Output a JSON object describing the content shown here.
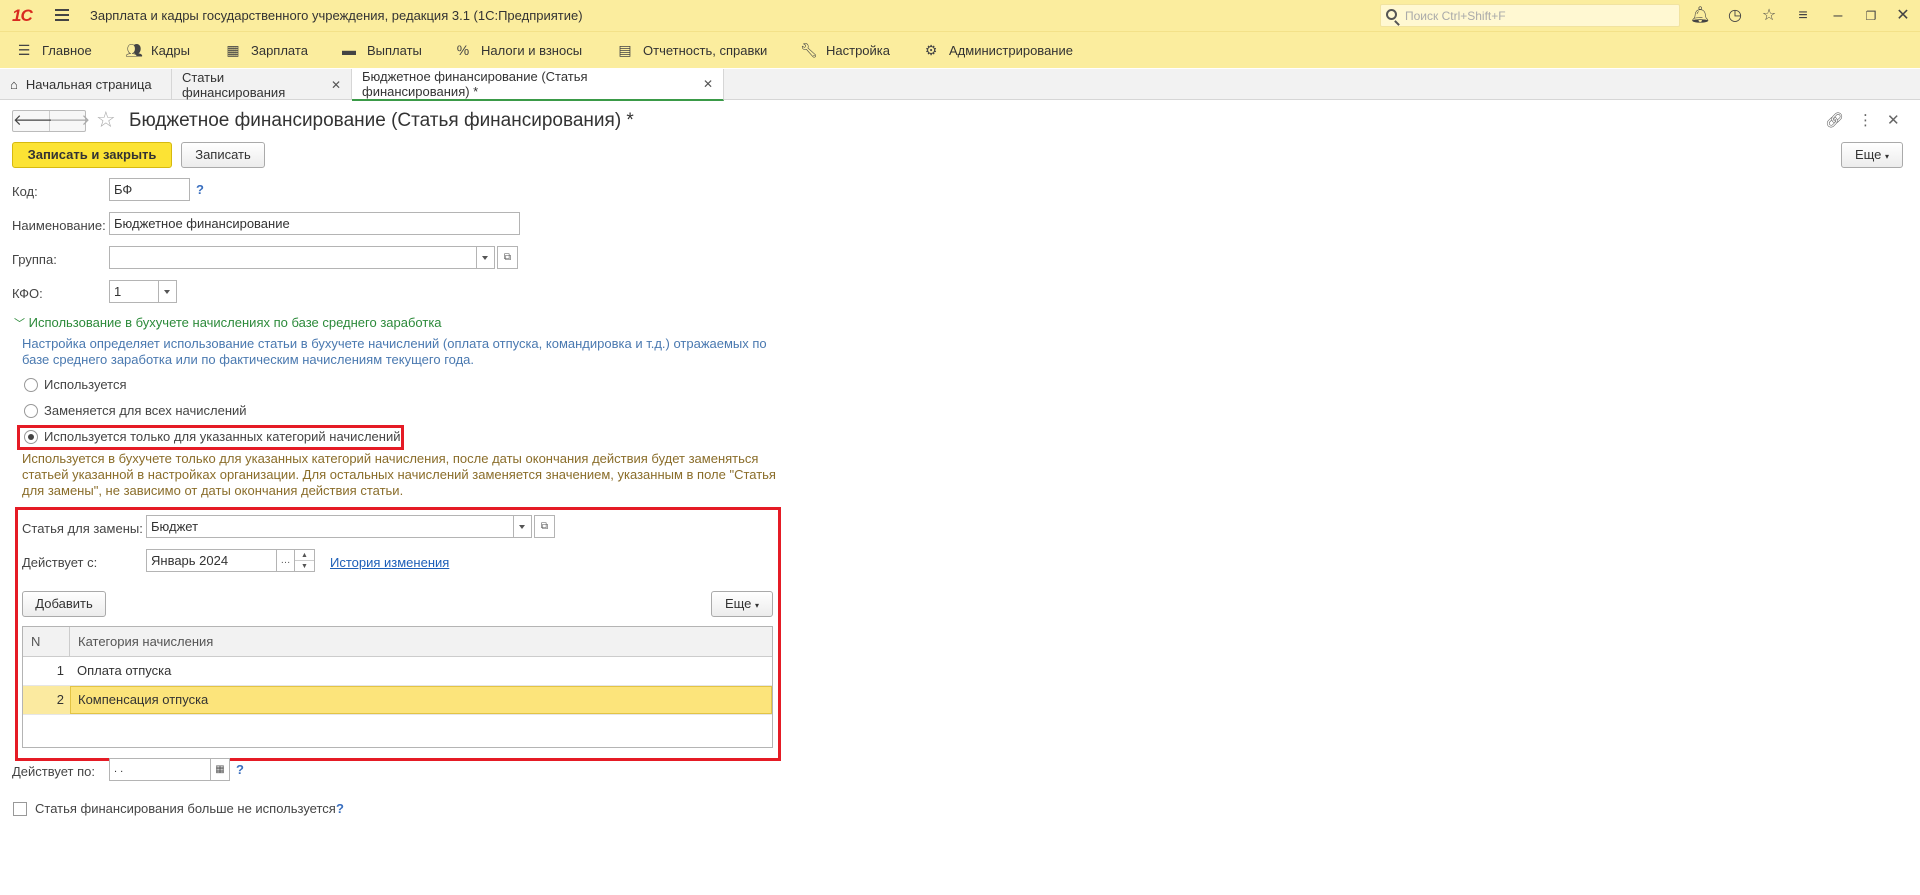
{
  "app": {
    "logo": "1С",
    "title": "Зарплата и кадры государственного учреждения, редакция 3.1  (1С:Предприятие)",
    "search_placeholder": "Поиск Ctrl+Shift+F"
  },
  "menu": [
    {
      "label": "Главное",
      "icon": "hamburger-icon"
    },
    {
      "label": "Кадры",
      "icon": "people-icon"
    },
    {
      "label": "Зарплата",
      "icon": "calculator-icon"
    },
    {
      "label": "Выплаты",
      "icon": "wallet-icon"
    },
    {
      "label": "Налоги и взносы",
      "icon": "percent-icon"
    },
    {
      "label": "Отчетность, справки",
      "icon": "report-icon"
    },
    {
      "label": "Настройка",
      "icon": "wrench-icon"
    },
    {
      "label": "Администрирование",
      "icon": "gear-icon"
    }
  ],
  "tabs": [
    {
      "label": "Начальная страница"
    },
    {
      "label": "Статьи финансирования"
    },
    {
      "label": "Бюджетное финансирование (Статья финансирования) *"
    }
  ],
  "form": {
    "title": "Бюджетное финансирование (Статья финансирования) *",
    "save_close_label": "Записать и закрыть",
    "save_label": "Записать",
    "more_label": "Еще",
    "code_label": "Код:",
    "code_value": "БФ",
    "name_label": "Наименование:",
    "name_value": "Бюджетное финансирование",
    "group_label": "Группа:",
    "group_value": "",
    "kfo_label": "КФО:",
    "kfo_value": "1",
    "section_title": "Использование в бухучете начислениях по базе среднего заработка",
    "section_note_1": "Настройка определяет использование статьи в бухучете начислений (оплата отпуска, командировка и т.д.) отражаемых по",
    "section_note_2": "базе среднего заработка или по фактическим начислениям текущего года.",
    "radio_1": "Используется",
    "radio_2": "Заменяется для всех начислений",
    "radio_3": "Используется только для указанных категорий начислений",
    "radio_note_1": "Используется в бухучете только для указанных категорий начисления, после даты окончания действия будет заменяться",
    "radio_note_2": "статьей указанной в настройках организации. Для остальных начислений заменяется значением, указанным в поле \"Статья",
    "radio_note_3": "для замены\", не зависимо от даты окончания действия статьи.",
    "replace_label": "Статья для замены:",
    "replace_value": "Бюджет",
    "valid_from_label": "Действует с:",
    "valid_from_value": "Январь 2024",
    "history_link": "История изменения",
    "add_label": "Добавить",
    "table_more_label": "Еще",
    "valid_to_label": "Действует по:",
    "valid_to_value": " .  .",
    "not_used_label": "Статья финансирования больше не используется",
    "help": "?"
  },
  "table": {
    "columns": [
      "N",
      "Категория начисления"
    ],
    "rows": [
      {
        "n": "1",
        "category": "Оплата отпуска"
      },
      {
        "n": "2",
        "category": "Компенсация отпуска"
      }
    ]
  },
  "colors": {
    "header_bg": "#fbed9e",
    "primary_button": "#fce334",
    "highlight_red": "#e51b25",
    "group_green": "#2c8a3a",
    "selected_row": "#fce47b"
  }
}
